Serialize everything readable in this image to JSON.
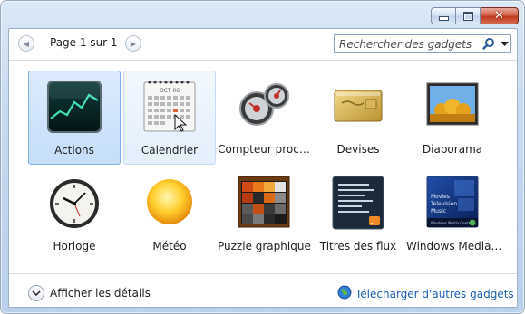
{
  "window": {
    "controls": {
      "minimize": "minimize",
      "maximize": "maximize",
      "close": "close"
    }
  },
  "toolbar": {
    "page_label": "Page 1 sur 1",
    "search_placeholder": "Rechercher des gadgets"
  },
  "gadgets": [
    {
      "label": "Actions",
      "icon": "stocks-chart-icon",
      "state": "selected"
    },
    {
      "label": "Calendrier",
      "icon": "calendar-icon",
      "state": "hover"
    },
    {
      "label": "Compteur proc…",
      "icon": "cpu-meter-icon",
      "state": "normal"
    },
    {
      "label": "Devises",
      "icon": "currency-card-icon",
      "state": "normal"
    },
    {
      "label": "Diaporama",
      "icon": "slideshow-icon",
      "state": "normal"
    },
    {
      "label": "Horloge",
      "icon": "clock-icon",
      "state": "normal"
    },
    {
      "label": "Météo",
      "icon": "weather-sun-icon",
      "state": "normal"
    },
    {
      "label": "Puzzle graphique",
      "icon": "puzzle-icon",
      "state": "normal"
    },
    {
      "label": "Titres des flux",
      "icon": "feed-headlines-icon",
      "state": "normal"
    },
    {
      "label": "Windows Media…",
      "icon": "media-center-icon",
      "state": "normal"
    }
  ],
  "calendar_month": "OCT 06",
  "media_center": {
    "menu": [
      "Movies",
      "Television",
      "Music"
    ],
    "brand": "Windows Media Center"
  },
  "footer": {
    "details_label": "Afficher les détails",
    "download_label": "Télécharger d'autres gadgets"
  },
  "colors": {
    "frame": "#c7daf0",
    "selection": "#c5defa",
    "link": "#1a5fb4",
    "close_button": "#c0391f"
  }
}
